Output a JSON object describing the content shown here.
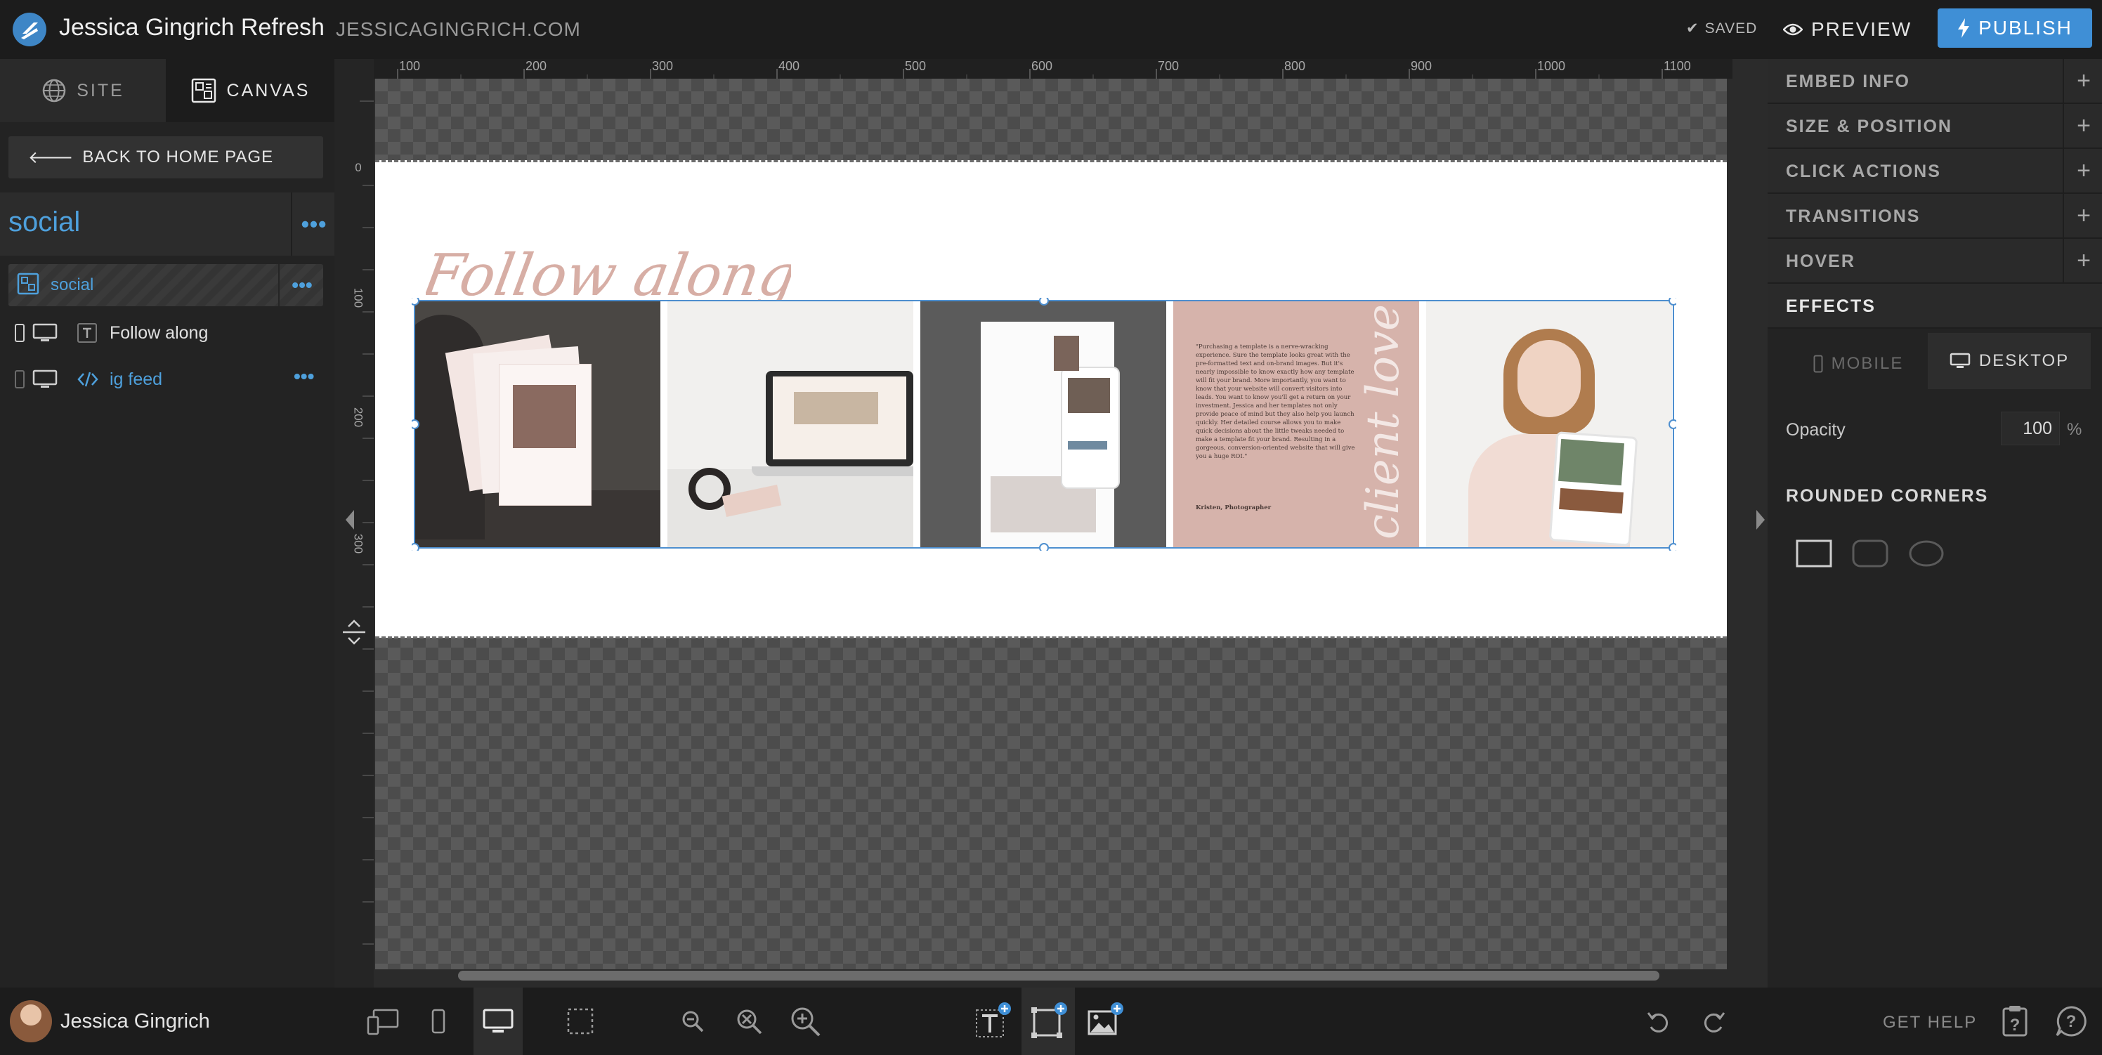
{
  "header": {
    "site_name": "Jessica Gingrich Refresh",
    "site_domain": "JESSICAGINGRICH.COM",
    "saved_label": "SAVED",
    "preview_label": "PREVIEW",
    "publish_label": "PUBLISH"
  },
  "left_panel": {
    "tabs": [
      {
        "label": "SITE"
      },
      {
        "label": "CANVAS"
      }
    ],
    "back_label": "BACK TO HOME PAGE",
    "page_name": "social",
    "section_name": "social",
    "layers": [
      {
        "label": "Follow along",
        "type": "text"
      },
      {
        "label": "ig feed",
        "type": "embed"
      }
    ]
  },
  "canvas": {
    "ruler_top_ticks": [
      "100",
      "200",
      "300",
      "400",
      "500",
      "600",
      "700",
      "800",
      "900",
      "1000",
      "1100"
    ],
    "ruler_left_ticks": [
      "0",
      "100",
      "200",
      "300"
    ],
    "heading_text": "Follow along",
    "feed_tile_text": "\"Purchasing a template is a nerve-wracking experience. Sure the template looks great with the pre-formatted text and on-brand images. But it's nearly impossible to know exactly how any template will fit your brand. More importantly, you want to know that your website will convert visitors into leads. You want to know you'll get a return on your investment. Jessica and her templates not only provide peace of mind but they also help you launch quickly. Her detailed course allows you to make quick decisions about the little tweaks needed to make a template fit your brand. Resulting in a gorgeous, conversion-oriented website that will give you a huge ROI.\"",
    "feed_tile_attribution": "Kristen, Photographer",
    "feed_tile_script": "client love"
  },
  "right_panel": {
    "sections": [
      {
        "label": "EMBED INFO"
      },
      {
        "label": "SIZE & POSITION"
      },
      {
        "label": "CLICK ACTIONS"
      },
      {
        "label": "TRANSITIONS"
      },
      {
        "label": "HOVER"
      }
    ],
    "effects_label": "EFFECTS",
    "device_tabs": [
      {
        "label": "MOBILE"
      },
      {
        "label": "DESKTOP"
      }
    ],
    "opacity_label": "Opacity",
    "opacity_value": "100",
    "opacity_unit": "%",
    "rounded_label": "ROUNDED CORNERS"
  },
  "footer": {
    "user_name": "Jessica Gingrich",
    "help_label": "GET HELP"
  },
  "colors": {
    "accent": "#3f8fd6",
    "link_blue": "#4ea0dc",
    "heading_pink": "#d7aea5",
    "tile_pink": "#d6b3ab"
  }
}
